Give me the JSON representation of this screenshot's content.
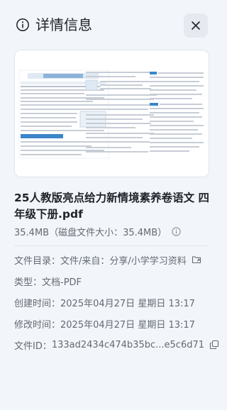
{
  "header": {
    "title": "详情信息"
  },
  "file": {
    "name": "25人教版亮点给力新情境素养卷语文 四年级下册.pdf",
    "size_text": "35.4MB（磁盘文件大小：35.4MB）"
  },
  "details": {
    "directory_label": "文件目录：",
    "directory_value": "文件/来自：分享/小学学习资料",
    "type_label": "类型：",
    "type_value": "文档-PDF",
    "created_label": "创建时间：",
    "created_value": "2025年04月27日 星期日 13:17",
    "modified_label": "修改时间：",
    "modified_value": "2025年04月27日 星期日 13:17",
    "id_label": "文件ID：",
    "id_value": "133ad2434c474b35bc...e5c6d71"
  },
  "icons": {
    "info": "info-circle-icon",
    "close": "close-icon",
    "size_info": "info-circle-icon",
    "open_folder": "folder-link-icon",
    "copy": "copy-icon"
  },
  "colors": {
    "background": "#f2f5fa",
    "text_primary": "#1f2329",
    "text_secondary": "#646a73",
    "preview_accent": "#3a86c8"
  }
}
